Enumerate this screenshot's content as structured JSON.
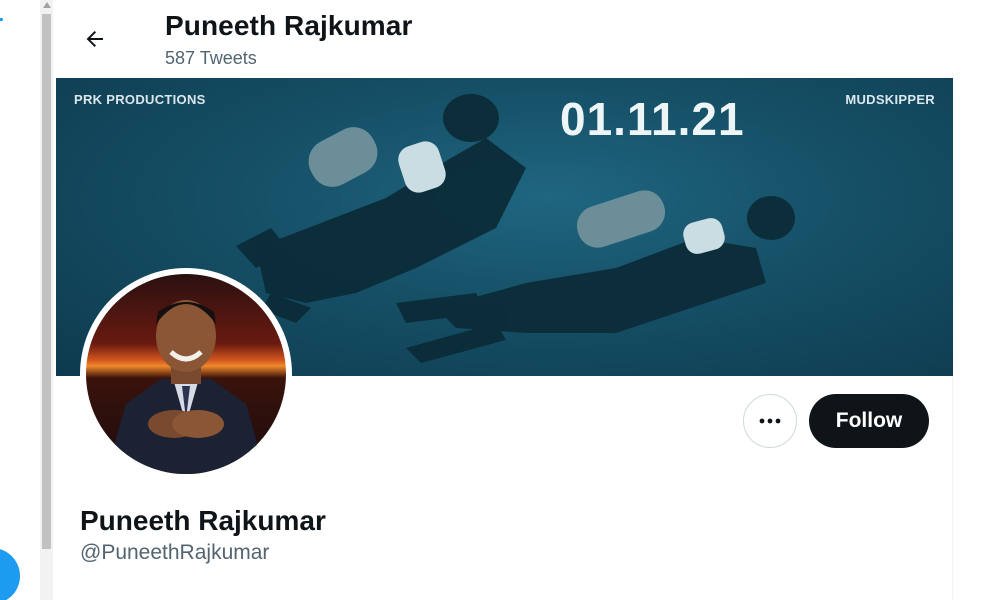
{
  "header": {
    "back_label": "Back",
    "title": "Puneeth Rajkumar",
    "subtitle": "587 Tweets"
  },
  "banner": {
    "left_text": "PRK PRODUCTIONS",
    "right_text": "MUDSKIPPER",
    "date_text": "01.11.21"
  },
  "profile": {
    "name": "Puneeth Rajkumar",
    "handle": "@PuneethRajkumar"
  },
  "actions": {
    "follow_label": "Follow",
    "more_label": "More"
  },
  "colors": {
    "accent": "#1d9bf0",
    "follow_bg": "#0f1419",
    "secondary_text": "#536471"
  },
  "icons": [
    "back-arrow-icon",
    "more-dots-icon",
    "compose-icon"
  ]
}
